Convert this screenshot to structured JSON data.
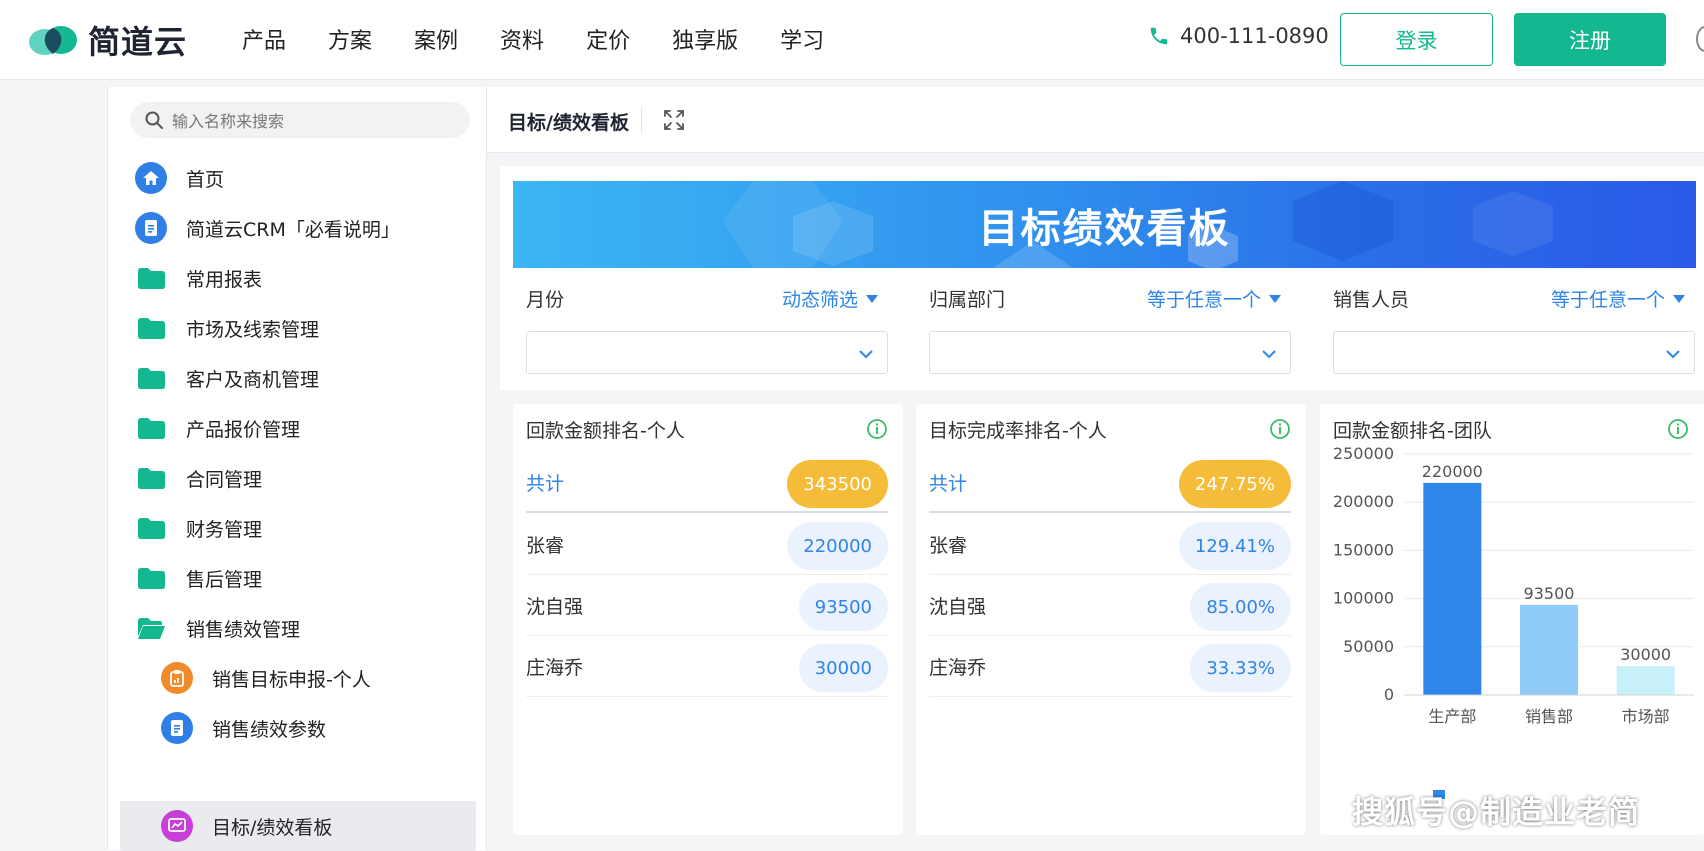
{
  "brand": {
    "name": "简道云"
  },
  "nav": {
    "items": [
      "产品",
      "方案",
      "案例",
      "资料",
      "定价",
      "独享版",
      "学习"
    ]
  },
  "header": {
    "phone": "400-111-0890",
    "login_label": "登录",
    "register_label": "注册"
  },
  "sidebar": {
    "search_placeholder": "输入名称来搜索",
    "items": [
      {
        "label": "首页",
        "icon": "home-icon"
      },
      {
        "label": "简道云CRM「必看说明」",
        "icon": "document-icon"
      },
      {
        "label": "常用报表",
        "icon": "folder-icon"
      },
      {
        "label": "市场及线索管理",
        "icon": "folder-icon"
      },
      {
        "label": "客户及商机管理",
        "icon": "folder-icon"
      },
      {
        "label": "产品报价管理",
        "icon": "folder-icon"
      },
      {
        "label": "合同管理",
        "icon": "folder-icon"
      },
      {
        "label": "财务管理",
        "icon": "folder-icon"
      },
      {
        "label": "售后管理",
        "icon": "folder-icon"
      },
      {
        "label": "销售绩效管理",
        "icon": "folder-open-icon"
      },
      {
        "label": "销售目标申报-个人",
        "icon": "clipboard-icon"
      },
      {
        "label": "销售绩效参数",
        "icon": "document-icon"
      },
      {
        "label": "目标/绩效看板",
        "icon": "chart-icon"
      }
    ]
  },
  "content": {
    "title": "目标/绩效看板"
  },
  "dashboard": {
    "banner_title": "目标绩效看板",
    "filters": [
      {
        "label": "月份",
        "mode": "动态筛选"
      },
      {
        "label": "归属部门",
        "mode": "等于任意一个"
      },
      {
        "label": "销售人员",
        "mode": "等于任意一个"
      }
    ],
    "cards": [
      {
        "title": "回款金额排名-个人",
        "total_label": "共计",
        "total_value": "343500",
        "rows": [
          {
            "name": "张睿",
            "value": "220000"
          },
          {
            "name": "沈自强",
            "value": "93500"
          },
          {
            "name": "庄海乔",
            "value": "30000"
          }
        ]
      },
      {
        "title": "目标完成率排名-个人",
        "total_label": "共计",
        "total_value": "247.75%",
        "rows": [
          {
            "name": "张睿",
            "value": "129.41%"
          },
          {
            "name": "沈自强",
            "value": "85.00%"
          },
          {
            "name": "庄海乔",
            "value": "33.33%"
          }
        ]
      }
    ],
    "team_chart_title": "回款金额排名-团队"
  },
  "colors": {
    "accent": "#14b890",
    "link_blue": "#2f84e5",
    "gold": "#f5bc3a"
  },
  "chart_data": {
    "type": "bar",
    "title": "回款金额排名-团队",
    "categories": [
      "生产部",
      "销售部",
      "市场部"
    ],
    "values": [
      220000,
      93500,
      30000
    ],
    "ylim": [
      0,
      250000
    ],
    "yticks": [
      0,
      50000,
      100000,
      150000,
      200000,
      250000
    ],
    "data_labels": true,
    "grid": true,
    "bar_colors": [
      "#2f86ea",
      "#8ecbf7",
      "#c8f0f9"
    ]
  },
  "watermark": "搜狐号@制造业老简"
}
